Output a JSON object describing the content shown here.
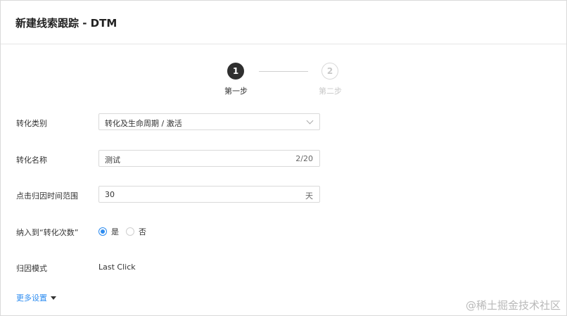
{
  "window": {
    "title": "新建线索跟踪 - DTM"
  },
  "steps": [
    {
      "number": "1",
      "label": "第一步"
    },
    {
      "number": "2",
      "label": "第二步"
    }
  ],
  "form": {
    "conversion_type": {
      "label": "转化类别",
      "value": "转化及生命周期 / 激活"
    },
    "conversion_name": {
      "label": "转化名称",
      "value": "测试",
      "counter": "2/20"
    },
    "attribution_window": {
      "label": "点击归因时间范围",
      "value": "30",
      "unit": "天"
    },
    "include_in_count": {
      "label": "纳入到“转化次数”",
      "options": [
        "是",
        "否"
      ],
      "selected": "是"
    },
    "attribution_model": {
      "label": "归因模式",
      "value": "Last Click"
    },
    "more_settings": {
      "label": "更多设置"
    }
  },
  "watermark": "@稀土掘金技术社区",
  "colors": {
    "accent": "#2d8cf0",
    "step_active": "#2f2f2f",
    "step_inactive": "#c8c8c8"
  }
}
